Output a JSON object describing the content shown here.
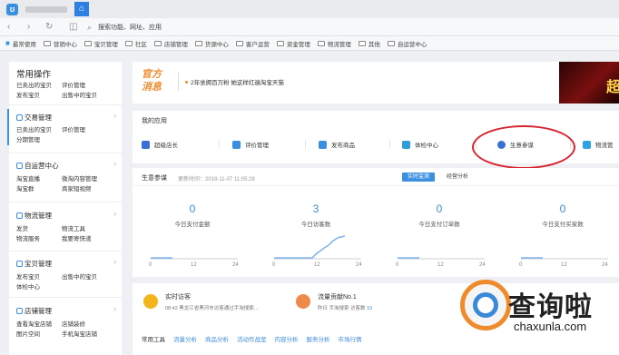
{
  "browser": {
    "home_icon": "home-icon",
    "search_placeholder": "搜索功能、网址、应用",
    "bookmarks": [
      {
        "label": "最常使用",
        "icon": "star-icon"
      },
      {
        "label": "营销中心",
        "icon": "folder-icon"
      },
      {
        "label": "宝贝管理",
        "icon": "folder-icon"
      },
      {
        "label": "社区",
        "icon": "folder-icon"
      },
      {
        "label": "店铺管理",
        "icon": "folder-icon"
      },
      {
        "label": "货源中心",
        "icon": "folder-icon"
      },
      {
        "label": "客户运营",
        "icon": "folder-icon"
      },
      {
        "label": "资金管理",
        "icon": "folder-icon"
      },
      {
        "label": "物流管理",
        "icon": "folder-icon"
      },
      {
        "label": "其他",
        "icon": "folder-icon"
      },
      {
        "label": "自运营中心",
        "icon": "folder-icon"
      }
    ]
  },
  "sidebar": {
    "title": "常用操作",
    "common": [
      "已卖出的宝贝",
      "评价管理",
      "发布宝贝",
      "出售中的宝贝"
    ],
    "groups": [
      {
        "label": "交易管理",
        "items": [
          "已卖出的宝贝",
          "评价管理",
          "分期管理"
        ]
      },
      {
        "label": "自运营中心",
        "items": [
          "淘宝直播",
          "微淘内容管理",
          "淘宝群",
          "商家短视频"
        ]
      },
      {
        "label": "物流管理",
        "items": [
          "发货",
          "物流工具",
          "物流服务",
          "我要寄快递"
        ]
      },
      {
        "label": "宝贝管理",
        "items": [
          "发布宝贝",
          "出售中的宝贝",
          "体检中心"
        ]
      },
      {
        "label": "店铺管理",
        "items": [
          "查看淘宝店铺",
          "店铺装修",
          "图片空间",
          "手机淘宝店铺"
        ]
      }
    ]
  },
  "notice": {
    "logo": "官方消息",
    "text": "2年坐拥百万粉 她这样红遍淘宝天猫",
    "banner_text": "超"
  },
  "apps": {
    "title": "我的应用",
    "items": [
      {
        "label": "超级店长",
        "color": "#3b6fd8"
      },
      {
        "label": "评价管理",
        "color": "#3b8fe0"
      },
      {
        "label": "发布商品",
        "color": "#3b8fe0"
      },
      {
        "label": "体检中心",
        "color": "#2f9bd8"
      },
      {
        "label": "生意参谋",
        "color": "#3b6fd8"
      },
      {
        "label": "物流管",
        "color": "#2fa3e0"
      }
    ]
  },
  "stats": {
    "title": "生意参谋",
    "update_time": "更新时间：2018-11-07 11:05:28",
    "tab_live": "实时监测",
    "tab_biz": "经营分析",
    "metrics": [
      {
        "value": "0",
        "label": "今日支付金额"
      },
      {
        "value": "3",
        "label": "今日访客数"
      },
      {
        "value": "0",
        "label": "今日支付订单数"
      },
      {
        "value": "0",
        "label": "今日支付买家数"
      }
    ],
    "ticks": [
      "0",
      "12",
      "24"
    ]
  },
  "visitors": {
    "title": "实时访客",
    "sub": "08:42 黑龙江省黑河市访客通过手淘搜索...",
    "traffic_title": "流量贡献No.1",
    "traffic_sub_prefix": "昨日 手淘搜索 访客数",
    "traffic_count": "10"
  },
  "tools": {
    "label": "常用工具",
    "links": [
      "流量分析",
      "商品分析",
      "活动作战室",
      "内容分析",
      "服务分析",
      "市场行情"
    ]
  },
  "watermark": {
    "title": "查询啦",
    "url": "chaxunla.com"
  }
}
